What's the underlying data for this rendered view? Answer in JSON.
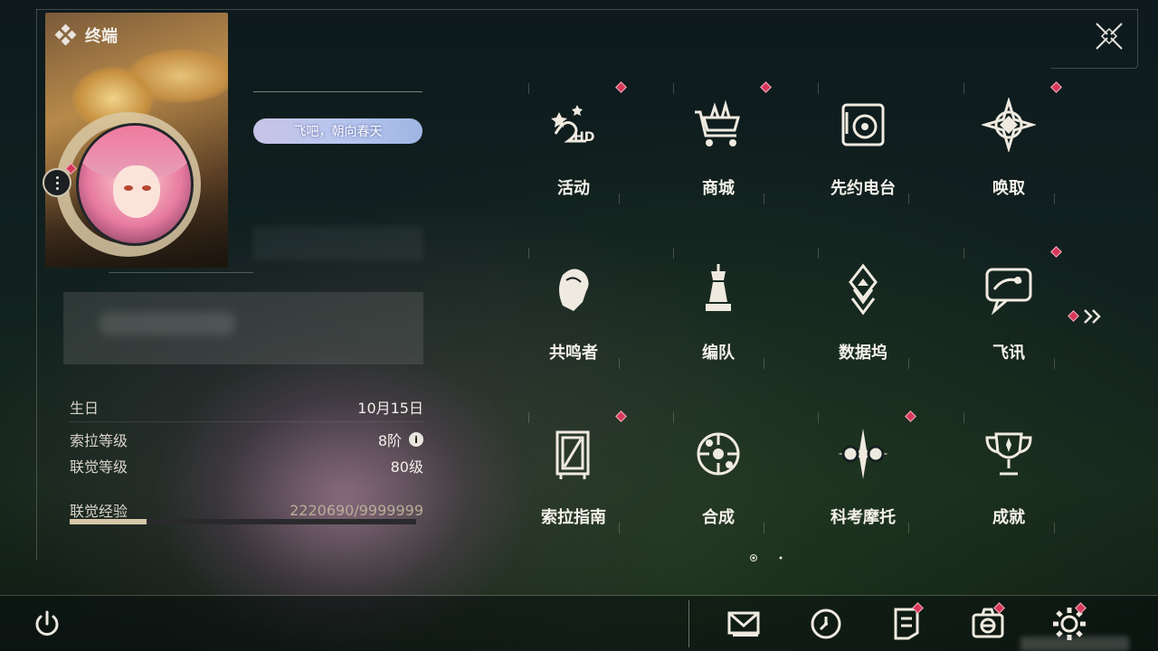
{
  "header": {
    "title": "终端"
  },
  "profile": {
    "signature": "飞吧，朝向春天",
    "birthday_label": "生日",
    "birthday_value": "10月15日",
    "sola_level_label": "索拉等级",
    "sola_level_value": "8阶",
    "union_level_label": "联觉等级",
    "union_level_value": "80级",
    "union_exp_label": "联觉经验",
    "union_exp_value": "2220690/9999999",
    "union_exp_progress": 0.222
  },
  "grid": {
    "items": [
      {
        "id": "activity",
        "label": "活动",
        "icon": "events-2nd-anniversary-icon",
        "badge": true
      },
      {
        "id": "shop",
        "label": "商城",
        "icon": "shop-cart-icon",
        "badge": true
      },
      {
        "id": "radio",
        "label": "先约电台",
        "icon": "radio-record-icon",
        "badge": false
      },
      {
        "id": "convene",
        "label": "唤取",
        "icon": "convene-compass-icon",
        "badge": true
      },
      {
        "id": "resonators",
        "label": "共鸣者",
        "icon": "resonator-portrait-icon",
        "badge": false
      },
      {
        "id": "team",
        "label": "编队",
        "icon": "team-chess-icon",
        "badge": false
      },
      {
        "id": "databank",
        "label": "数据坞",
        "icon": "databank-icon",
        "badge": false
      },
      {
        "id": "messages",
        "label": "飞讯",
        "icon": "chat-bubble-icon",
        "badge": true
      },
      {
        "id": "guidebook",
        "label": "索拉指南",
        "icon": "guidebook-icon",
        "badge": true
      },
      {
        "id": "synthesis",
        "label": "合成",
        "icon": "synthesis-icon",
        "badge": false
      },
      {
        "id": "kokomoto",
        "label": "科考摩托",
        "icon": "motorcycle-icon",
        "badge": true
      },
      {
        "id": "achievements",
        "label": "成就",
        "icon": "trophy-icon",
        "badge": false
      }
    ]
  },
  "pagination": {
    "current": 1,
    "total": 2
  },
  "bottom_bar": {
    "items": [
      {
        "id": "mail",
        "icon": "mail-icon",
        "badge": false
      },
      {
        "id": "clock",
        "icon": "clock-icon",
        "badge": false
      },
      {
        "id": "notice",
        "icon": "notice-icon",
        "badge": true
      },
      {
        "id": "camera",
        "icon": "camera-icon",
        "badge": true
      },
      {
        "id": "settings",
        "icon": "gear-icon",
        "badge": true
      }
    ]
  },
  "colors": {
    "badge_red": "#d8385a",
    "exp_fill": "#d6c7a8",
    "text_primary": "#f4f1ea"
  }
}
